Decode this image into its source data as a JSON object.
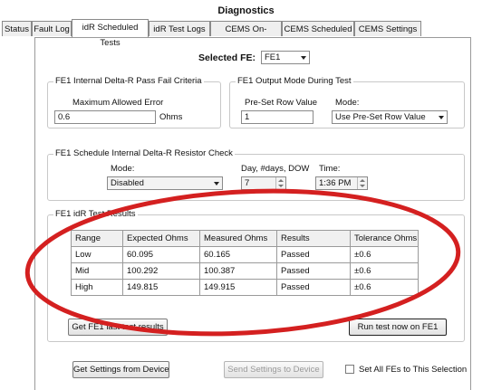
{
  "window": {
    "title": "Diagnostics"
  },
  "tabs": [
    {
      "label": "Status"
    },
    {
      "label": "Fault Log"
    },
    {
      "label": "idR Scheduled Tests"
    },
    {
      "label": "idR Test Logs"
    },
    {
      "label": "CEMS On-Demand"
    },
    {
      "label": "CEMS Scheduled"
    },
    {
      "label": "CEMS Settings"
    }
  ],
  "selected_fe": {
    "label": "Selected FE:",
    "value": "FE1"
  },
  "pass_fail": {
    "title": "FE1 Internal Delta-R Pass Fail Criteria",
    "max_error_label": "Maximum Allowed Error",
    "max_error_value": "0.6",
    "unit": "Ohms"
  },
  "output_mode": {
    "title": "FE1 Output Mode During Test",
    "preset_label": "Pre-Set Row Value",
    "preset_value": "1",
    "mode_label": "Mode:",
    "mode_value": "Use Pre-Set Row Value"
  },
  "schedule": {
    "title": "FE1 Schedule Internal Delta-R Resistor Check",
    "mode_label": "Mode:",
    "mode_value": "Disabled",
    "day_label": "Day, #days, DOW",
    "day_value": "7",
    "time_label": "Time:",
    "time_value": "1:36 PM"
  },
  "results": {
    "title": "FE1 idR Test Results",
    "columns": [
      "Range",
      "Expected Ohms",
      "Measured Ohms",
      "Results",
      "Tolerance Ohms"
    ],
    "rows": [
      [
        "Low",
        "60.095",
        "60.165",
        "Passed",
        "±0.6"
      ],
      [
        "Mid",
        "100.292",
        "100.387",
        "Passed",
        "±0.6"
      ],
      [
        "High",
        "149.815",
        "149.915",
        "Passed",
        "±0.6"
      ]
    ],
    "get_last_button": "Get FE1 last test results",
    "run_test_button": "Run test now on FE1"
  },
  "footer": {
    "get_settings_button": "Get Settings from Device",
    "send_settings_button": "Send Settings to Device",
    "set_all_label": "Set All FEs to This Selection",
    "set_all_checked": false
  },
  "colors": {
    "highlight_ellipse": "#d42020"
  }
}
